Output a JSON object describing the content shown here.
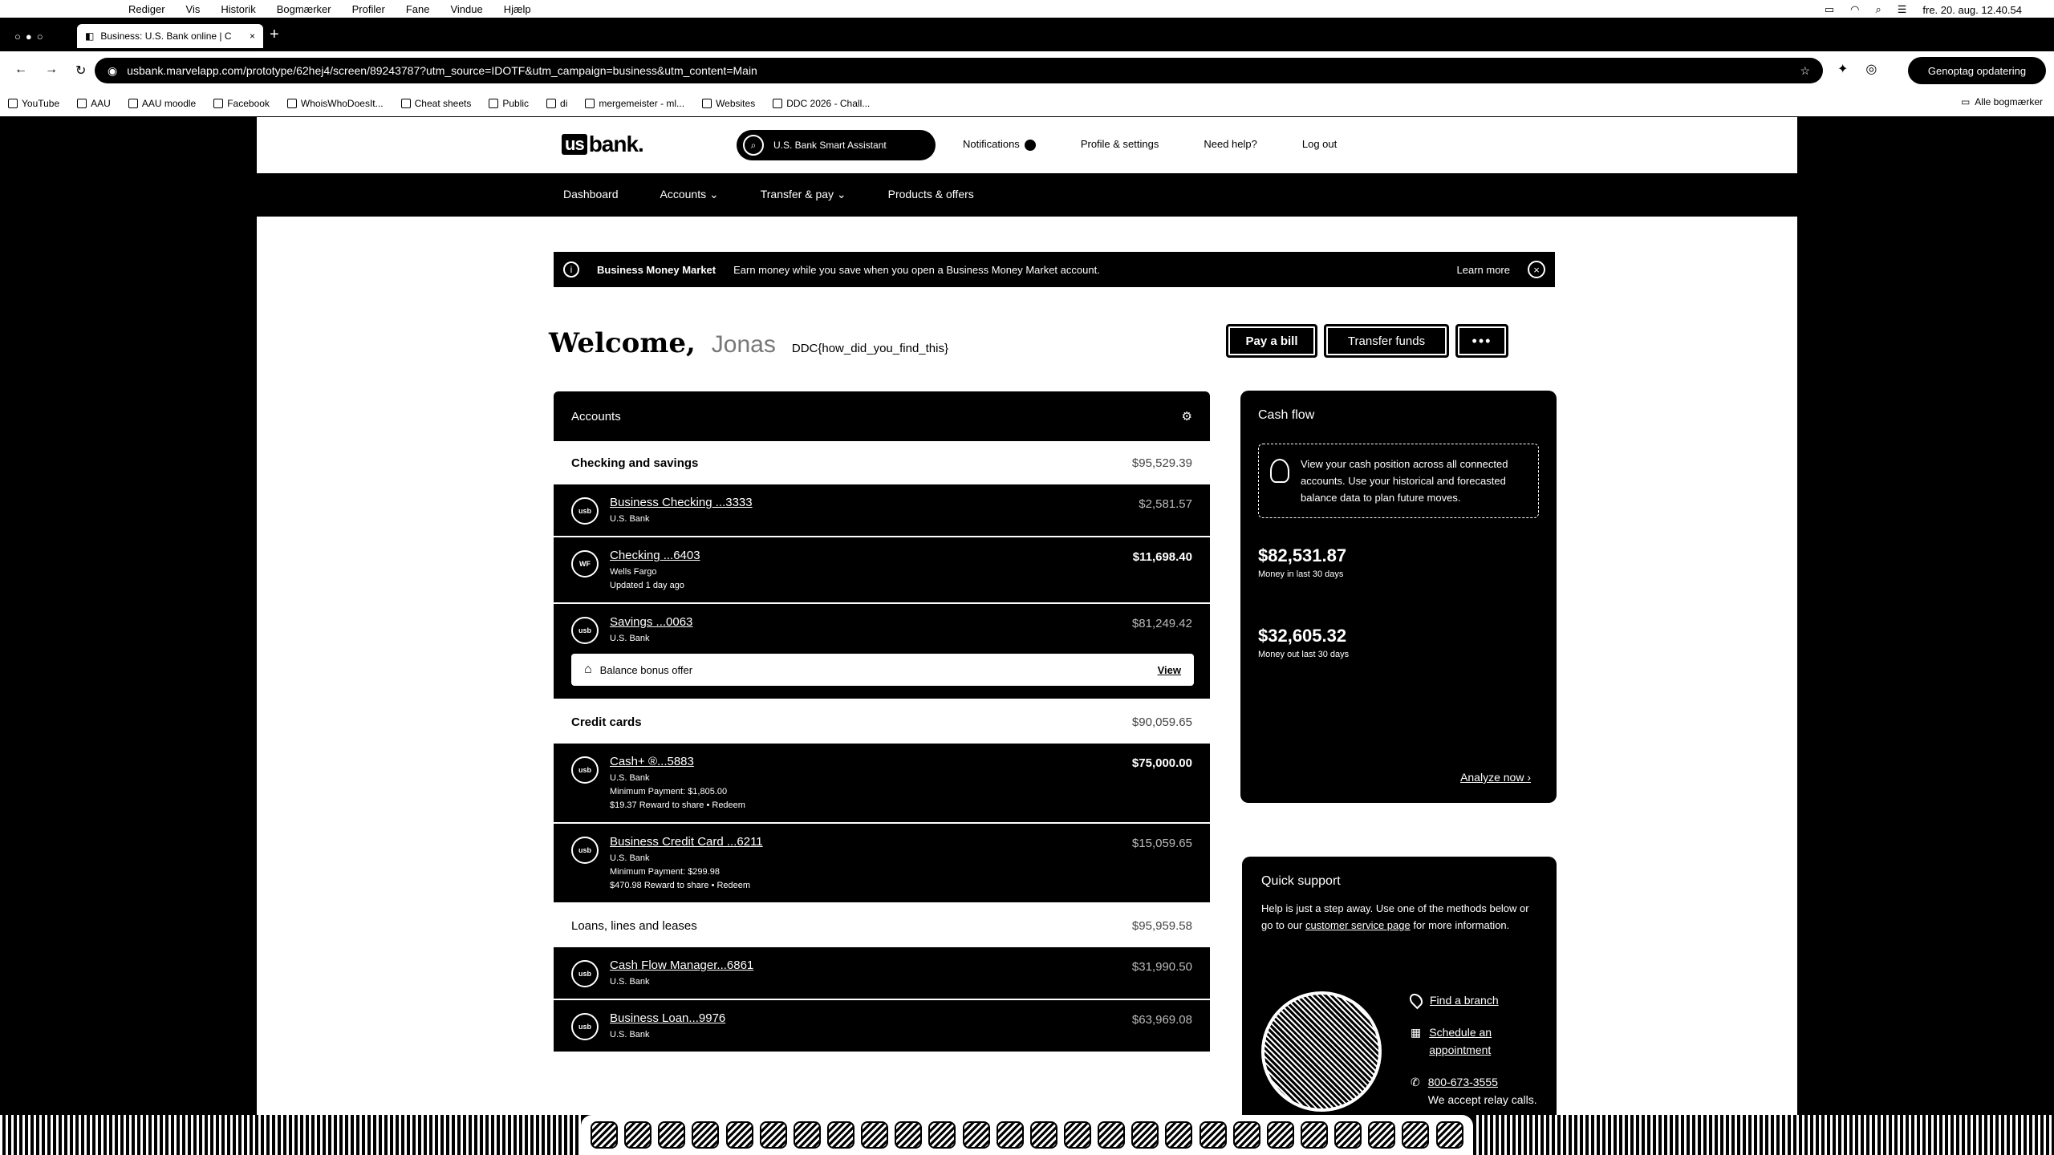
{
  "menubar": {
    "apple": "",
    "items": [
      "Rediger",
      "Vis",
      "Historik",
      "Bogmærker",
      "Profiler",
      "Fane",
      "Vindue",
      "Hjælp"
    ],
    "datetime": "fre. 20. aug. 12.40.54"
  },
  "browser": {
    "tab_title": "Business: U.S. Bank online | C",
    "url": "usbank.marvelapp.com/prototype/62hej4/screen/89243787?utm_source=IDOTF&utm_campaign=business&utm_content=Main",
    "update_button": "Genoptag opdatering",
    "bookmarks": [
      "YouTube",
      "AAU",
      "AAU moodle",
      "Facebook",
      "WhoisWhoDoesIt...",
      "Cheat sheets",
      "Public",
      "di",
      "mergemeister - ml...",
      "Websites",
      "DDC 2026 - Chall..."
    ],
    "all_bookmarks": "Alle bogmærker"
  },
  "site": {
    "logo_us": "us",
    "logo_bank": "bank.",
    "assistant_label": "U.S. Bank Smart Assistant",
    "header_links": {
      "notifications": "Notifications",
      "profile": "Profile & settings",
      "help": "Need help?",
      "logout": "Log out"
    },
    "nav": [
      "Dashboard",
      "Accounts ⌄",
      "Transfer & pay ⌄",
      "Products & offers"
    ]
  },
  "banner": {
    "title": "Business Money Market",
    "message": "Earn money while you save when you open a Business Money Market account.",
    "link": "Learn more"
  },
  "welcome": {
    "heading": "Welcome,",
    "name": "Jonas",
    "flag": "DDC{how_did_you_find_this}"
  },
  "actions": {
    "pay": "Pay a bill",
    "transfer": "Transfer funds",
    "more": "•••"
  },
  "accounts": {
    "title": "Accounts",
    "groups": [
      {
        "title": "Checking and savings",
        "total": "$95,529.39",
        "rows": [
          {
            "name": "Business Checking ...3333",
            "sub": [
              "U.S. Bank"
            ],
            "balance": "$2,581.57",
            "dim": true
          },
          {
            "name": "Checking ...6403",
            "sub": [
              "Wells Fargo",
              "Updated 1 day ago"
            ],
            "balance": "$11,698.40",
            "dim": false
          },
          {
            "name": "Savings ...0063",
            "sub": [
              "U.S. Bank"
            ],
            "balance": "$81,249.42",
            "dim": true
          }
        ],
        "bonus": {
          "label": "Balance bonus offer",
          "link": "View"
        }
      },
      {
        "title": "Credit cards",
        "total": "$90,059.65",
        "rows": [
          {
            "name": "Cash+ ®...5883",
            "sub": [
              "U.S. Bank",
              "Minimum Payment: $1,805.00",
              "$19.37 Reward to share • Redeem"
            ],
            "balance": "$75,000.00",
            "dim": false
          },
          {
            "name": "Business Credit Card ...6211",
            "sub": [
              "U.S. Bank",
              "Minimum Payment: $299.98",
              "$470.98 Reward to share • Redeem"
            ],
            "balance": "$15,059.65",
            "dim": true
          }
        ]
      },
      {
        "title": "Loans, lines and leases",
        "total": "$95,959.58",
        "plain": true,
        "rows": [
          {
            "name": "Cash Flow Manager...6861",
            "sub": [
              "U.S. Bank"
            ],
            "balance": "$31,990.50",
            "dim": true
          },
          {
            "name": "Business Loan...9976",
            "sub": [
              "U.S. Bank"
            ],
            "balance": "$63,969.08",
            "dim": true
          }
        ]
      }
    ]
  },
  "cashflow": {
    "title": "Cash flow",
    "tip": "View your cash position across all connected accounts. Use your historical and forecasted balance data to plan future moves.",
    "money_in": {
      "value": "$82,531.87",
      "caption": "Money in last 30 days"
    },
    "money_out": {
      "value": "$32,605.32",
      "caption": "Money out last 30 days"
    },
    "analyze": "Analyze now ›"
  },
  "support": {
    "title": "Quick support",
    "text_before": "Help is just a step away. Use one of the methods below or go to our ",
    "text_link": "customer service page",
    "text_after": " for more information.",
    "links": {
      "branch": "Find a branch",
      "appointment": "Schedule an appointment",
      "phone": "800-673-3555",
      "relay": "We accept relay calls."
    }
  }
}
